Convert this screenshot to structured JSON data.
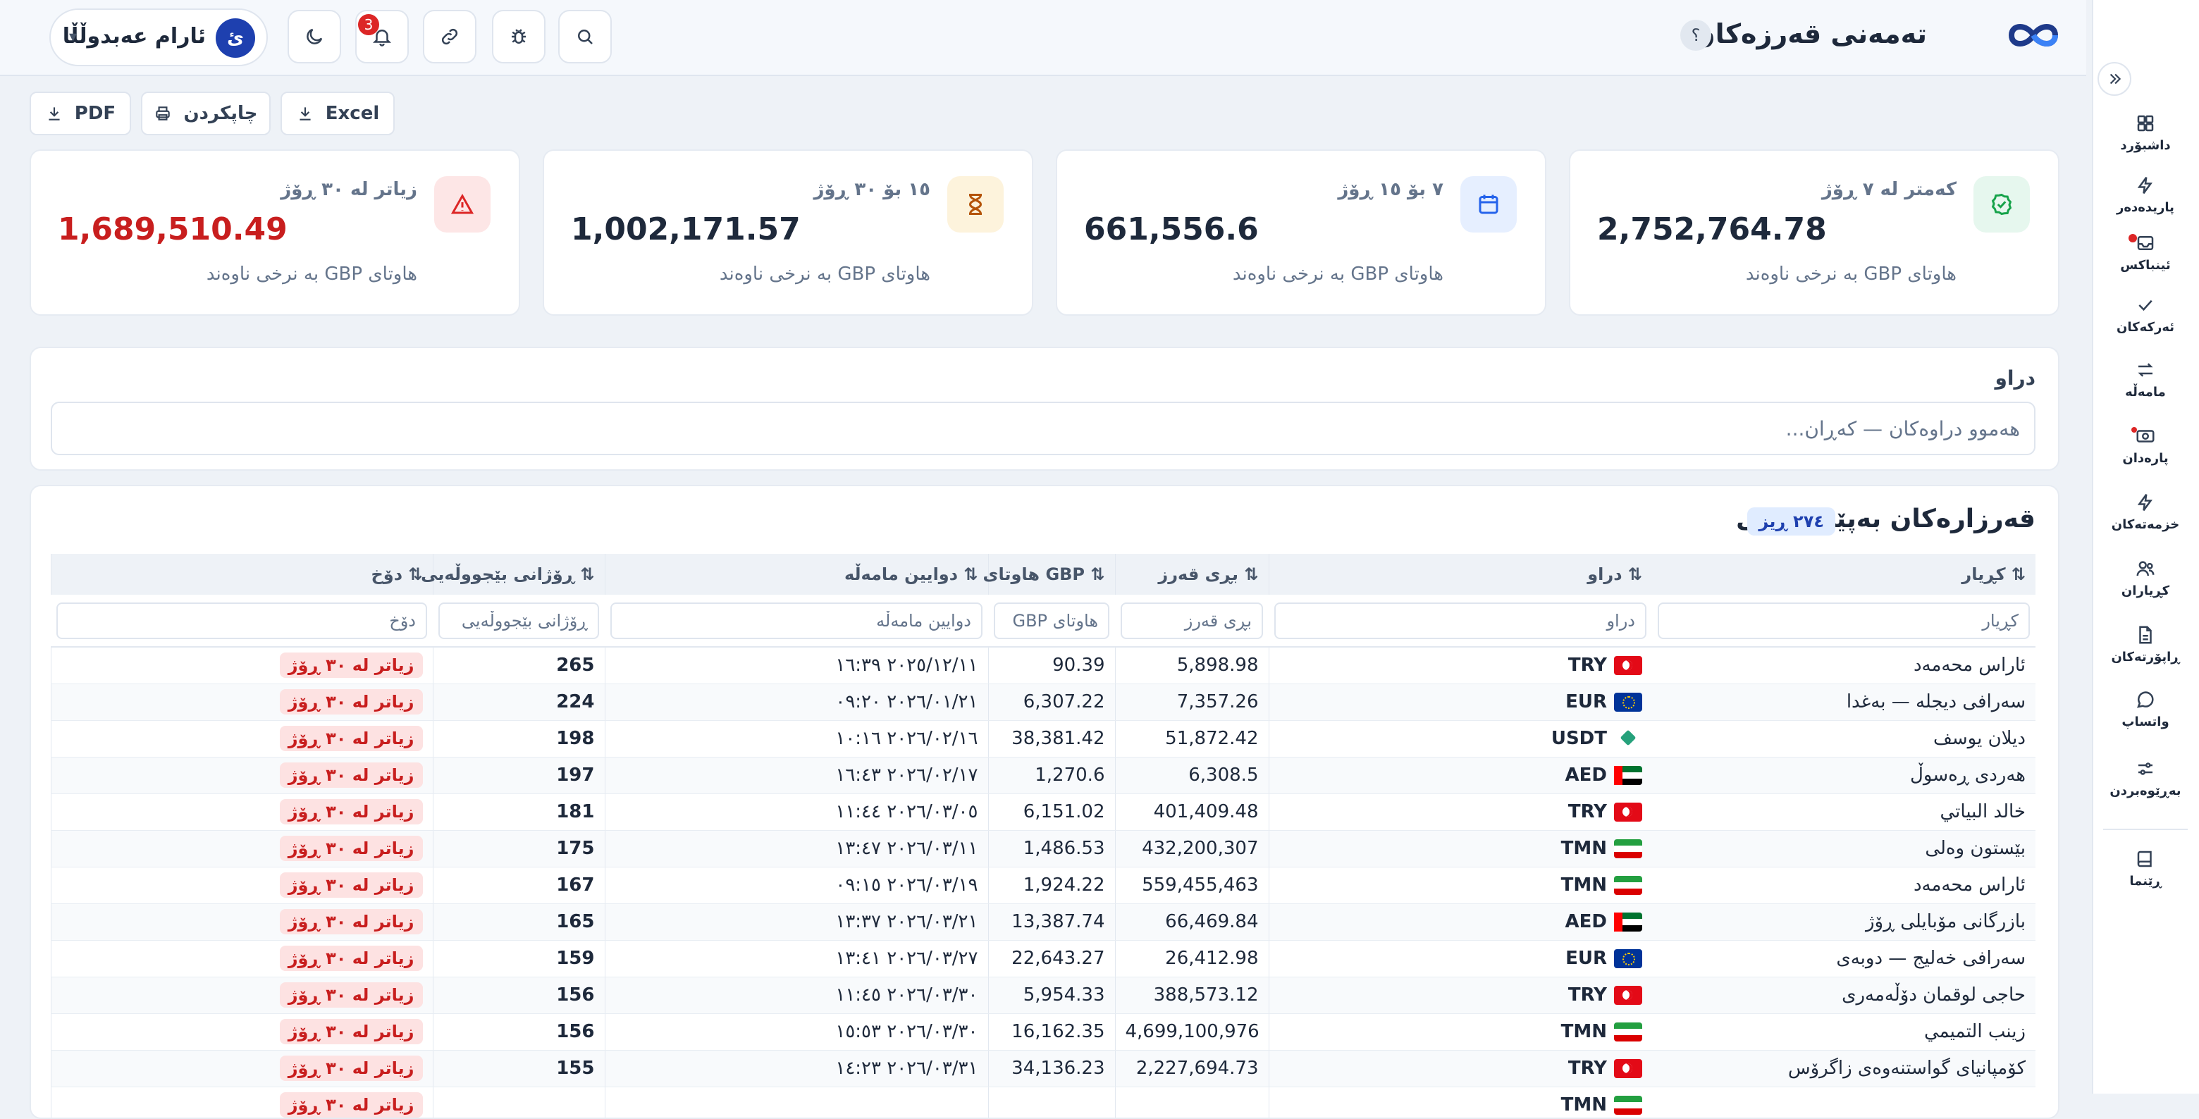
{
  "header": {
    "title": "تەمەنی قەرزەکان",
    "help": "؟",
    "user": {
      "name": "ئارام عەبدوڵڵا",
      "initial": "ئ"
    },
    "notification_count": "3",
    "caret": "▾"
  },
  "sidebar": {
    "items": [
      {
        "label": "داشبۆرد",
        "icon": "dashboard-icon"
      },
      {
        "label": "پاریدەدەر",
        "icon": "bolt-icon"
      },
      {
        "label": "ئینباکس",
        "icon": "inbox-icon"
      },
      {
        "label": "ئەرکەکان",
        "icon": "check-icon"
      },
      {
        "label": "مامەڵە",
        "icon": "swap-icon"
      },
      {
        "label": "پارەدان",
        "icon": "cash-icon"
      },
      {
        "label": "خزمەتەکان",
        "icon": "bolt-icon"
      },
      {
        "label": "کڕیاران",
        "icon": "users-icon"
      },
      {
        "label": "ڕاپۆرتەکان",
        "icon": "report-icon"
      },
      {
        "label": "واتساپ",
        "icon": "chat-icon"
      },
      {
        "label": "بەڕێوەبردن",
        "icon": "sliders-icon"
      },
      {
        "label": "ڕێنما",
        "icon": "book-icon"
      }
    ]
  },
  "export": {
    "excel": "Excel",
    "print": "چاپکردن",
    "pdf": "PDF"
  },
  "stats": [
    {
      "label": "کەمتر لە ٧ ڕۆژ",
      "value": "2,752,764.78",
      "note": "هاوتای GBP بە نرخی ناوەند",
      "icon": "check-circle-icon",
      "accent": "#16a34a",
      "bg": "#e6f7ee"
    },
    {
      "label": "٧ بۆ ١٥ ڕۆژ",
      "value": "661,556.6",
      "note": "هاوتای GBP بە نرخی ناوەند",
      "icon": "calendar-icon",
      "accent": "#2563eb",
      "bg": "#e6efff"
    },
    {
      "label": "١٥ بۆ ٣٠ ڕۆژ",
      "value": "1,002,171.57",
      "note": "هاوتای GBP بە نرخی ناوەند",
      "icon": "hourglass-icon",
      "accent": "#b45309",
      "bg": "#fdf3dc"
    },
    {
      "label": "زیاتر لە ٣٠ ڕۆژ",
      "value": "1,689,510.49",
      "note": "هاوتای GBP بە نرخی ناوەند",
      "icon": "warning-icon",
      "accent": "#dc2626",
      "bg": "#fde6e6"
    }
  ],
  "filter": {
    "label": "دراو",
    "value": "هەموو دراوەکان — کەڕان..."
  },
  "table": {
    "title": "قەرزارەکان بەپێی کۆنی",
    "count": "٢٧٤ ڕیز",
    "columns": [
      {
        "label": "⇅ کڕیار",
        "placeholder": "کڕیار"
      },
      {
        "label": "⇅ دراو",
        "placeholder": "دراو"
      },
      {
        "label": "⇅ بڕی قەرز",
        "placeholder": "بڕی قەرز"
      },
      {
        "label": "⇅ GBP هاوتای",
        "placeholder": "هاوتای GBP"
      },
      {
        "label": "⇅ دوایین مامەڵە",
        "placeholder": "دوایین مامەڵە"
      },
      {
        "label": "⇅ ڕۆژانی بێجووڵەیی",
        "placeholder": "ڕۆژانی بێجووڵەیی"
      },
      {
        "label": "⇅ دۆخ",
        "placeholder": "دۆخ"
      }
    ],
    "rows": [
      {
        "customer": "ئاراس محەمەد",
        "currency": "TRY",
        "amount": "5,898.98",
        "gbp": "90.39",
        "last": "٢٠٢٥/١٢/١١ ١٦:٣٩",
        "days": "265",
        "status": "زیاتر لە ٣٠ ڕۆژ"
      },
      {
        "customer": "سەرافی دیجلە — بەغدا",
        "currency": "EUR",
        "amount": "7,357.26",
        "gbp": "6,307.22",
        "last": "٢٠٢٦/٠١/٢١ ٠٩:٢٠",
        "days": "224",
        "status": "زیاتر لە ٣٠ ڕۆژ"
      },
      {
        "customer": "دیلان یوسف",
        "currency": "USDT",
        "amount": "51,872.42",
        "gbp": "38,381.42",
        "last": "٢٠٢٦/٠٢/١٦ ١٠:١٦",
        "days": "198",
        "status": "زیاتر لە ٣٠ ڕۆژ"
      },
      {
        "customer": "هەردی ڕەسوڵ",
        "currency": "AED",
        "amount": "6,308.5",
        "gbp": "1,270.6",
        "last": "٢٠٢٦/٠٢/١٧ ١٦:٤٣",
        "days": "197",
        "status": "زیاتر لە ٣٠ ڕۆژ"
      },
      {
        "customer": "خالد البياتي",
        "currency": "TRY",
        "amount": "401,409.48",
        "gbp": "6,151.02",
        "last": "٢٠٢٦/٠٣/٠٥ ١١:٤٤",
        "days": "181",
        "status": "زیاتر لە ٣٠ ڕۆژ"
      },
      {
        "customer": "بێستون وەلی",
        "currency": "TMN",
        "amount": "432,200,307",
        "gbp": "1,486.53",
        "last": "٢٠٢٦/٠٣/١١ ١٣:٤٧",
        "days": "175",
        "status": "زیاتر لە ٣٠ ڕۆژ"
      },
      {
        "customer": "ئاراس محەمەد",
        "currency": "TMN",
        "amount": "559,455,463",
        "gbp": "1,924.22",
        "last": "٢٠٢٦/٠٣/١٩ ٠٩:١٥",
        "days": "167",
        "status": "زیاتر لە ٣٠ ڕۆژ"
      },
      {
        "customer": "بازرگانی مۆبایلی ڕۆژ",
        "currency": "AED",
        "amount": "66,469.84",
        "gbp": "13,387.74",
        "last": "٢٠٢٦/٠٣/٢١ ١٣:٣٧",
        "days": "165",
        "status": "زیاتر لە ٣٠ ڕۆژ"
      },
      {
        "customer": "سەرافی خەلیج — دوبەی",
        "currency": "EUR",
        "amount": "26,412.98",
        "gbp": "22,643.27",
        "last": "٢٠٢٦/٠٣/٢٧ ١٣:٤١",
        "days": "159",
        "status": "زیاتر لە ٣٠ ڕۆژ"
      },
      {
        "customer": "حاجی لوقمان دۆڵەمەری",
        "currency": "TRY",
        "amount": "388,573.12",
        "gbp": "5,954.33",
        "last": "٢٠٢٦/٠٣/٣٠ ١١:٤٥",
        "days": "156",
        "status": "زیاتر لە ٣٠ ڕۆژ"
      },
      {
        "customer": "زينب التميمي",
        "currency": "TMN",
        "amount": "4,699,100,976",
        "gbp": "16,162.35",
        "last": "٢٠٢٦/٠٣/٣٠ ١٥:٥٣",
        "days": "156",
        "status": "زیاتر لە ٣٠ ڕۆژ"
      },
      {
        "customer": "کۆمپانیای گواستنەوەی زاگرۆس",
        "currency": "TRY",
        "amount": "2,227,694.73",
        "gbp": "34,136.23",
        "last": "٢٠٢٦/٠٣/٣١ ١٤:٢٣",
        "days": "155",
        "status": "زیاتر لە ٣٠ ڕۆژ"
      },
      {
        "customer": "",
        "currency": "TMN",
        "amount": "",
        "gbp": "",
        "last": "",
        "days": "",
        "status": "زیاتر لە ٣٠ ڕۆژ"
      }
    ]
  }
}
